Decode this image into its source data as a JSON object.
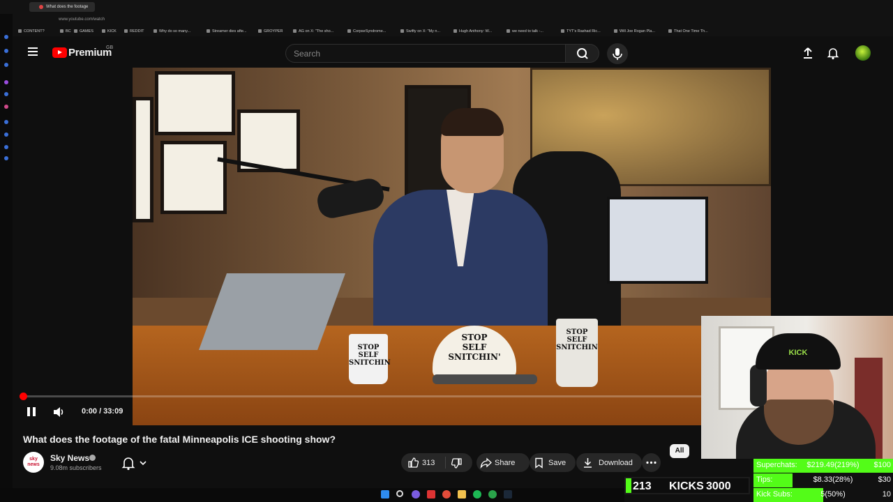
{
  "browser": {
    "tab_title": "What does the footage",
    "url": "www.youtube.com/watch",
    "bookmarks": [
      "CONTENT?",
      "BC",
      "GAMES",
      "KICK",
      "REDDIT",
      "Why do so many...",
      "Streamer dies afte...",
      "GROYPER",
      "AG on X: \"The sho...",
      "CorpseSyndrome...",
      "Swifty on X: \"My n...",
      "Hugh Anthony: W...",
      "we need to talk -...",
      "TYT's Rashad Ric...",
      "Will Joe Rogan Pla...",
      "That One Time Th..."
    ]
  },
  "header": {
    "logo_text": "Premium",
    "country_code": "GB",
    "search_placeholder": "Search"
  },
  "video_frame": {
    "mug_text": "STOP\nSELF\nSNITCHIN",
    "cap_text": "STOP\nSELF\nSNITCHIN'"
  },
  "player": {
    "time": "0:00 / 33:09",
    "progress_fraction": 0.005
  },
  "video": {
    "title": "What does the footage of the fatal Minneapolis ICE shooting show?",
    "channel_name": "Sky News",
    "channel_logo_text": "sky\nnews",
    "subscribers": "9.08m subscribers",
    "likes": "313",
    "share_label": "Share",
    "save_label": "Save",
    "download_label": "Download",
    "filter_all_label": "All"
  },
  "webcam": {
    "cap_text": "KICK"
  },
  "overlay": {
    "kicks": {
      "count": "213",
      "label": "KICKS",
      "goal": "3000"
    },
    "stats": [
      {
        "name": "Superchats:",
        "value": "$219.49(219%)",
        "goal": "$100",
        "fill": 1.0
      },
      {
        "name": "Tips:",
        "value": "$8.33(28%)",
        "goal": "$30",
        "fill": 0.28
      },
      {
        "name": "Kick Subs:",
        "value": "5(50%)",
        "goal": "10",
        "fill": 0.5
      }
    ]
  },
  "colors": {
    "yt_red": "#ff0000",
    "kick_green": "#53fc18",
    "background": "#0f0f0f"
  }
}
